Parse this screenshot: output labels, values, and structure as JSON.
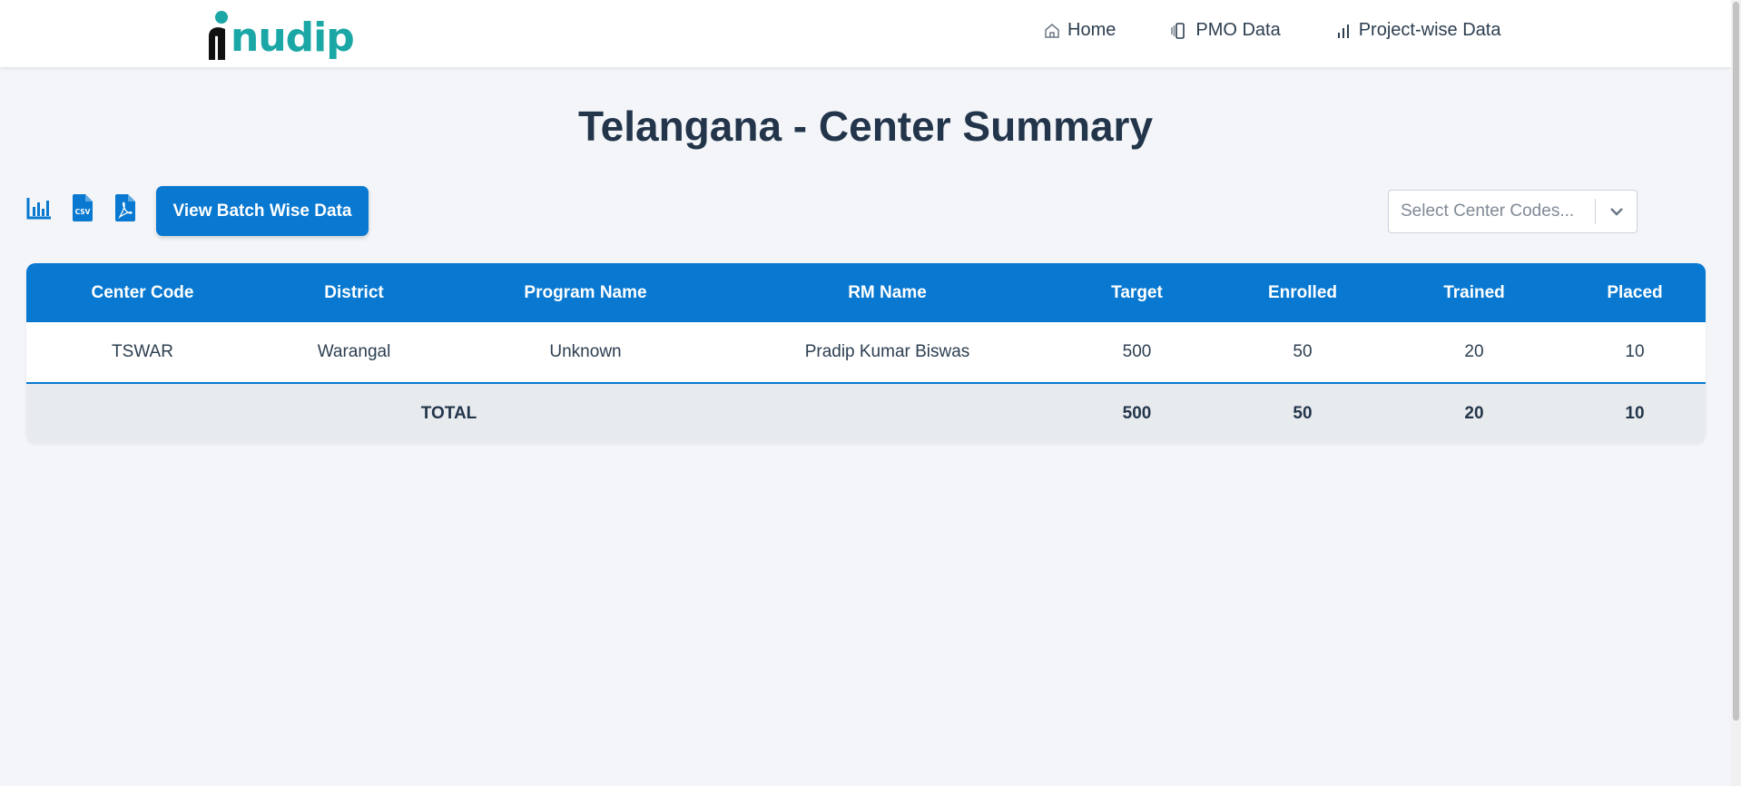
{
  "brand": {
    "name": "nudip",
    "colors": {
      "teal": "#1aa7a6",
      "dark": "#111111"
    }
  },
  "nav": [
    {
      "label": "Home",
      "icon": "home-icon"
    },
    {
      "label": "PMO Data",
      "icon": "mobile-icon"
    },
    {
      "label": "Project-wise Data",
      "icon": "bar-chart-icon"
    }
  ],
  "page": {
    "title": "Telangana - Center Summary"
  },
  "toolbar": {
    "icons": [
      "chart-icon",
      "csv-file-icon",
      "pdf-file-icon"
    ],
    "batch_button_label": "View Batch Wise Data",
    "select_placeholder": "Select Center Codes..."
  },
  "table": {
    "headers": [
      "Center Code",
      "District",
      "Program Name",
      "RM Name",
      "Target",
      "Enrolled",
      "Trained",
      "Placed"
    ],
    "rows": [
      [
        "TSWAR",
        "Warangal",
        "Unknown",
        "Pradip Kumar Biswas",
        "500",
        "50",
        "20",
        "10"
      ]
    ],
    "total": {
      "label": "TOTAL",
      "target": "500",
      "enrolled": "50",
      "trained": "20",
      "placed": "10"
    }
  },
  "colors": {
    "primary": "#0878d0",
    "background": "#f3f5f9",
    "total_row": "#e8ebee"
  }
}
